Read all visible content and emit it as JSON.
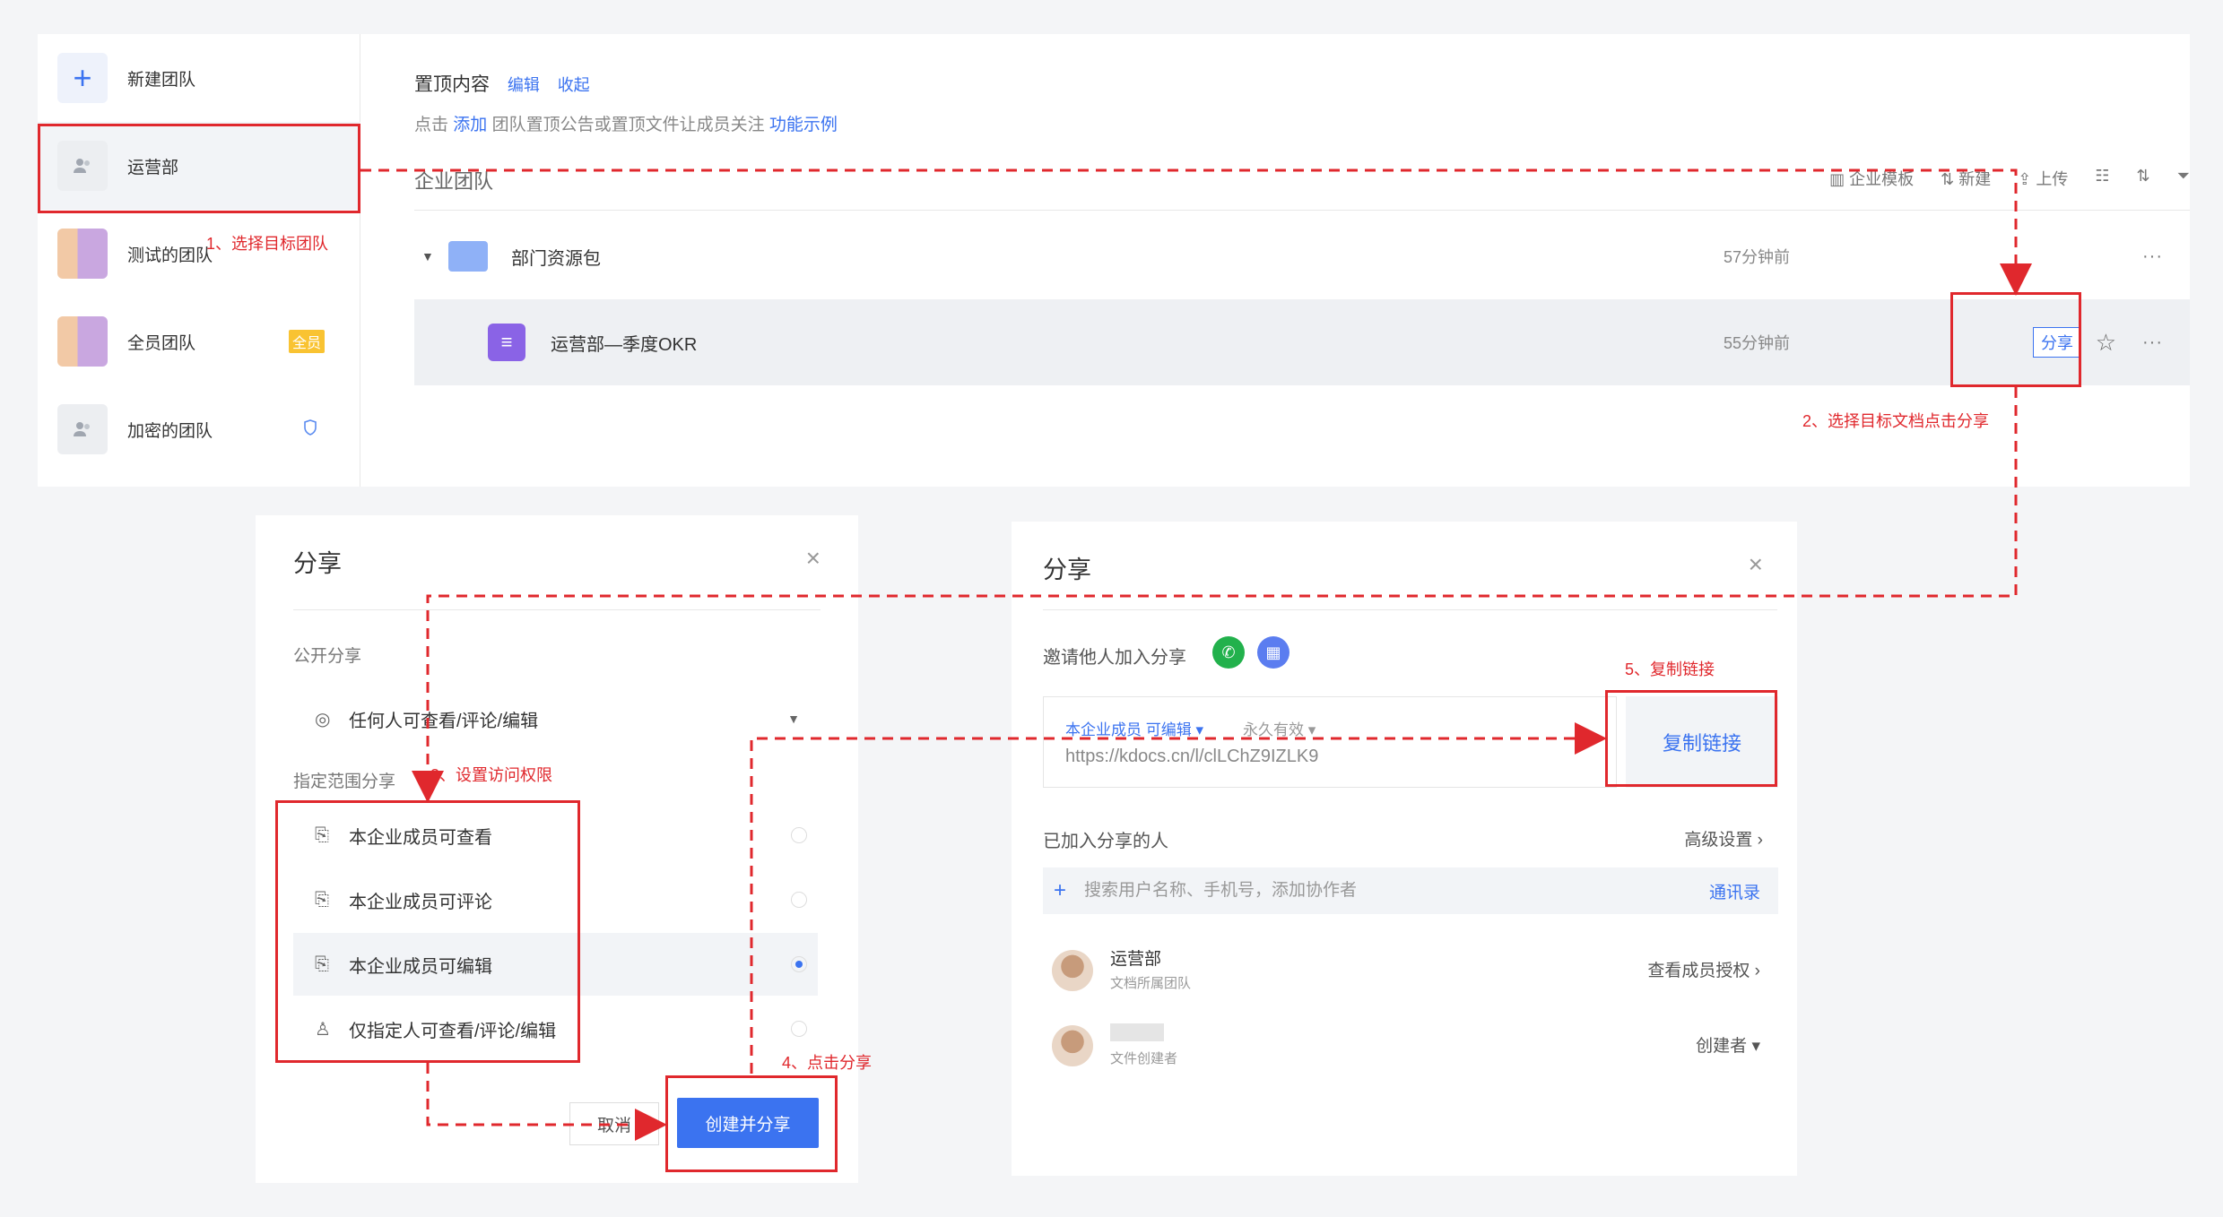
{
  "sidebar": {
    "items": [
      {
        "label": "新建团队",
        "icon": "plus-icon"
      },
      {
        "label": "运营部",
        "icon": "team-icon"
      },
      {
        "label": "测试的团队",
        "icon": "thumbnail-icon"
      },
      {
        "label": "全员团队",
        "icon": "thumbnail-icon",
        "badge": "全员"
      },
      {
        "label": "加密的团队",
        "icon": "team-icon"
      }
    ]
  },
  "main": {
    "pin_title": "置顶内容",
    "pin_edit": "编辑",
    "pin_collapse": "收起",
    "pin_hint_prefix": "点击",
    "pin_hint_add": "添加",
    "pin_hint_middle": "团队置顶公告或置顶文件让成员关注",
    "pin_hint_example": "功能示例",
    "section_title": "企业团队",
    "toolbar": {
      "template": "企业模板",
      "new": "新建",
      "upload": "上传"
    },
    "files": [
      {
        "name": "部门资源包",
        "time": "57分钟前",
        "type": "folder"
      },
      {
        "name": "运营部—季度OKR",
        "time": "55分钟前",
        "type": "doc",
        "share_label": "分享"
      }
    ]
  },
  "dialog_left": {
    "title": "分享",
    "public_label": "公开分享",
    "public_option": "任何人可查看/评论/编辑",
    "scope_label": "指定范围分享",
    "options": [
      {
        "label": "本企业成员可查看",
        "selected": false
      },
      {
        "label": "本企业成员可评论",
        "selected": false
      },
      {
        "label": "本企业成员可编辑",
        "selected": true
      },
      {
        "label": "仅指定人可查看/评论/编辑",
        "selected": false
      }
    ],
    "cancel": "取消",
    "create": "创建并分享"
  },
  "dialog_right": {
    "title": "分享",
    "invite_label": "邀请他人加入分享",
    "link_perm": "本企业成员 可编辑",
    "link_expiry": "永久有效",
    "link_url": "https://kdocs.cn/l/clLChZ9IZLK9",
    "copy": "复制链接",
    "joined_label": "已加入分享的人",
    "advanced": "高级设置",
    "search_placeholder": "搜索用户名称、手机号，添加协作者",
    "contacts": "通讯录",
    "members": [
      {
        "name": "运营部",
        "sub": "文档所属团队",
        "role": "查看成员授权"
      },
      {
        "name": "",
        "sub": "文件创建者",
        "role": "创建者"
      }
    ]
  },
  "annotations": {
    "step1": "1、选择目标团队",
    "step2": "2、选择目标文档点击分享",
    "step3": "3、设置访问权限",
    "step4": "4、点击分享",
    "step5": "5、复制链接"
  },
  "colors": {
    "accent": "#3b73f0",
    "annotation": "#e0282d",
    "badge": "#f9c332",
    "doc": "#8a63e6"
  }
}
